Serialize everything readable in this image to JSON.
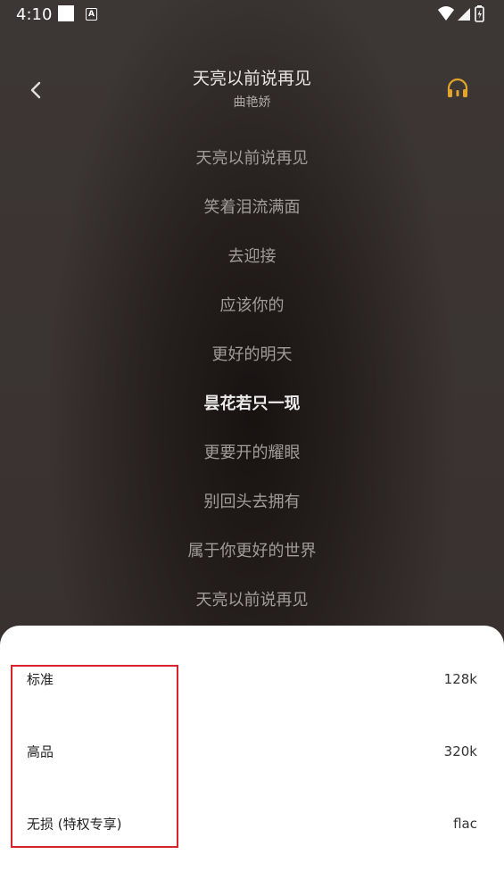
{
  "status_bar": {
    "time": "4:10",
    "a_icon_label": "A",
    "icons": [
      "square-icon",
      "a-icon",
      "wifi-icon",
      "signal-icon",
      "battery-icon"
    ]
  },
  "header": {
    "song_title": "天亮以前说再见",
    "artist": "曲艳娇",
    "back_icon": "chevron-left-icon",
    "headphones_icon": "headphones-icon",
    "headphones_color": "#e0a52a"
  },
  "lyrics": {
    "lines": [
      "天亮以前说再见",
      "笑着泪流满面",
      "去迎接",
      "应该你的",
      "更好的明天",
      "昙花若只一现",
      "更要开的耀眼",
      "别回头去拥有",
      "属于你更好的世界",
      "天亮以前说再见"
    ],
    "current_index": 5
  },
  "quality_sheet": {
    "options": [
      {
        "name": "标准",
        "rate": "128k"
      },
      {
        "name": "高品",
        "rate": "320k"
      },
      {
        "name": "无损 (特权专享)",
        "rate": "flac"
      }
    ],
    "highlight_color": "#d9232b"
  }
}
